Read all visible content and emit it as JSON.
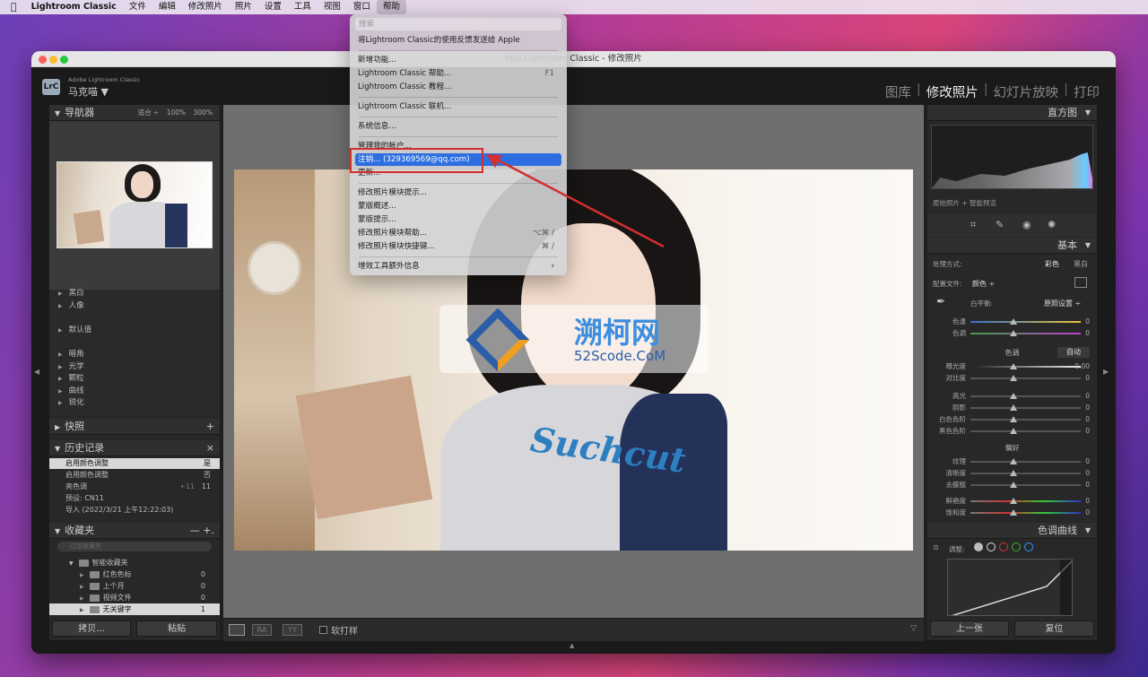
{
  "menubar": {
    "app": "Lightroom Classic",
    "items": [
      "文件",
      "编辑",
      "修改照片",
      "照片",
      "设置",
      "工具",
      "视图",
      "窗口",
      "帮助"
    ]
  },
  "window": {
    "title_visible": "hop Lightroom Classic - 修改照片"
  },
  "identity": {
    "logo": "LrC",
    "sub": "Adobe Lightroom Classic",
    "user": "马克喵 ▼"
  },
  "modules": [
    "图库",
    "修改照片",
    "幻灯片放映",
    "打印"
  ],
  "left": {
    "navigator": {
      "title": "导航器",
      "fit": "适合 ÷",
      "z1": "100%",
      "z2": "300%"
    },
    "presets": [
      "黑白",
      "人像",
      "默认值",
      "暗角",
      "光学",
      "颗粒",
      "曲线",
      "锐化"
    ],
    "snapshots": {
      "title": "快照",
      "add": "+"
    },
    "history": {
      "title": "历史记录",
      "close": "×",
      "rows": [
        {
          "label": "启用颜色调整",
          "mid": "",
          "value": "是"
        },
        {
          "label": "启用颜色调整",
          "mid": "",
          "value": "否"
        },
        {
          "label": "亮色调",
          "mid": "+11",
          "value": "11"
        },
        {
          "label": "预设: CN11",
          "mid": "",
          "value": ""
        },
        {
          "label": "导入 (2022/3/21 上午12:22:03)",
          "mid": "",
          "value": ""
        }
      ]
    },
    "collections": {
      "title": "收藏夹",
      "controls": "— +.",
      "search_placeholder": "过滤收藏夹",
      "rows": [
        {
          "label": "智能收藏夹",
          "value": ""
        },
        {
          "label": "红色色标",
          "value": "0"
        },
        {
          "label": "上个月",
          "value": "0"
        },
        {
          "label": "视频文件",
          "value": "0"
        },
        {
          "label": "无关键字",
          "value": "1"
        }
      ]
    },
    "copy": "拷贝...",
    "paste": "粘贴"
  },
  "center": {
    "photo_text": "Suchcut",
    "watermark_cn": "溯柯网",
    "watermark_en": "52Scode.CoM",
    "toolbar_label": "软打样"
  },
  "right": {
    "histogram": "直方图",
    "histogram_caption": "原始照片 + 智能预览",
    "basic": "基本",
    "treatment": {
      "label": "处理方式:",
      "color": "彩色",
      "bw": "黑白"
    },
    "profile": {
      "label": "配置文件:",
      "value": "颜色 ÷"
    },
    "wb": {
      "label": "白平衡:",
      "value": "原照设置 ÷"
    },
    "wb_sliders": [
      {
        "label": "色温",
        "value": "0"
      },
      {
        "label": "色调",
        "value": "0"
      }
    ],
    "tone": {
      "label": "色调",
      "auto": "自动"
    },
    "tone_sliders": [
      {
        "label": "曝光度",
        "value": "0.00"
      },
      {
        "label": "对比度",
        "value": "0"
      }
    ],
    "tone_sliders2": [
      {
        "label": "高光",
        "value": "0"
      },
      {
        "label": "阴影",
        "value": "0"
      },
      {
        "label": "白色色阶",
        "value": "0"
      },
      {
        "label": "黑色色阶",
        "value": "0"
      }
    ],
    "presence": "偏好",
    "presence_sliders": [
      {
        "label": "纹理",
        "value": "0"
      },
      {
        "label": "清晰度",
        "value": "0"
      },
      {
        "label": "去朦胧",
        "value": "0"
      }
    ],
    "presence_sliders2": [
      {
        "label": "鲜艳度",
        "value": "0"
      },
      {
        "label": "饱和度",
        "value": "0"
      }
    ],
    "tone_curve": "色调曲线",
    "curve_adjust": "调整:",
    "prev": "上一张",
    "reset": "复位"
  },
  "help_menu": {
    "search": "搜索",
    "items": [
      {
        "label": "将Lightroom Classic的使用反馈发送给 Apple",
        "shortcut": ""
      },
      {
        "label": "新增功能...",
        "shortcut": ""
      },
      {
        "label": "Lightroom Classic 帮助...",
        "shortcut": "F1"
      },
      {
        "label": "Lightroom Classic 教程...",
        "shortcut": ""
      },
      {
        "label": "Lightroom Classic 联机...",
        "shortcut": ""
      },
      {
        "label": "系统信息...",
        "shortcut": ""
      },
      {
        "label": "管理我的帐户...",
        "shortcut": ""
      },
      {
        "label": "注销... (329369569@qq.com)",
        "shortcut": ""
      },
      {
        "label": "更新...",
        "shortcut": ""
      },
      {
        "label": "修改照片模块提示...",
        "shortcut": ""
      },
      {
        "label": "蒙版概述...",
        "shortcut": ""
      },
      {
        "label": "蒙版提示...",
        "shortcut": ""
      },
      {
        "label": "修改照片模块帮助...",
        "shortcut": "⌥⌘ /"
      },
      {
        "label": "修改照片模块快捷键...",
        "shortcut": "⌘ /"
      },
      {
        "label": "增效工具额外信息",
        "shortcut": "›"
      }
    ]
  },
  "colors": {
    "highlight": "#2d6ee0",
    "annotation": "#d32f2f",
    "panel": "#282828"
  }
}
